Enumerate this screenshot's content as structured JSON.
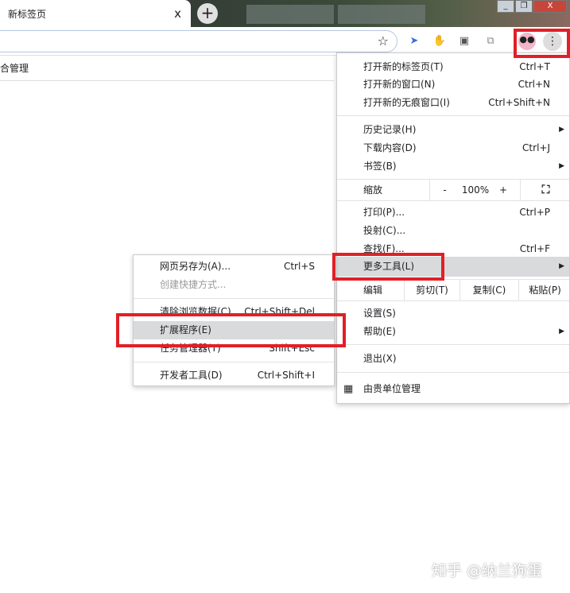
{
  "tab": {
    "title": "新标签页",
    "close": "x",
    "new_tab": "+"
  },
  "window": {
    "minimize": "_",
    "restore": "❐",
    "close": "X"
  },
  "page": {
    "partial_text": "合管理"
  },
  "menu": {
    "items": [
      {
        "label": "打开新的标签页(T)",
        "shortcut": "Ctrl+T"
      },
      {
        "label": "打开新的窗口(N)",
        "shortcut": "Ctrl+N"
      },
      {
        "label": "打开新的无痕窗口(I)",
        "shortcut": "Ctrl+Shift+N"
      },
      {
        "label": "历史记录(H)",
        "shortcut": ""
      },
      {
        "label": "下载内容(D)",
        "shortcut": "Ctrl+J"
      },
      {
        "label": "书签(B)",
        "shortcut": ""
      },
      {
        "label": "打印(P)...",
        "shortcut": "Ctrl+P"
      },
      {
        "label": "投射(C)...",
        "shortcut": ""
      },
      {
        "label": "查找(F)...",
        "shortcut": "Ctrl+F"
      },
      {
        "label": "更多工具(L)",
        "shortcut": ""
      },
      {
        "label": "设置(S)",
        "shortcut": ""
      },
      {
        "label": "帮助(E)",
        "shortcut": ""
      },
      {
        "label": "退出(X)",
        "shortcut": ""
      }
    ],
    "zoom": {
      "label": "缩放",
      "minus": "-",
      "value": "100%",
      "plus": "+",
      "fullscreen": "⛶"
    },
    "edit": {
      "label": "编辑",
      "cut": "剪切(T)",
      "copy": "复制(C)",
      "paste": "粘贴(P)"
    },
    "managed": "由贵单位管理"
  },
  "submenu": {
    "items": [
      {
        "label": "网页另存为(A)...",
        "shortcut": "Ctrl+S"
      },
      {
        "label": "创建快捷方式...",
        "shortcut": ""
      },
      {
        "label": "清除浏览数据(C)...",
        "shortcut": "Ctrl+Shift+Del"
      },
      {
        "label": "扩展程序(E)",
        "shortcut": ""
      },
      {
        "label": "任务管理器(T)",
        "shortcut": "Shift+Esc"
      },
      {
        "label": "开发者工具(D)",
        "shortcut": "Ctrl+Shift+I"
      }
    ]
  },
  "watermark": "知乎 @纳兰狗蛋"
}
